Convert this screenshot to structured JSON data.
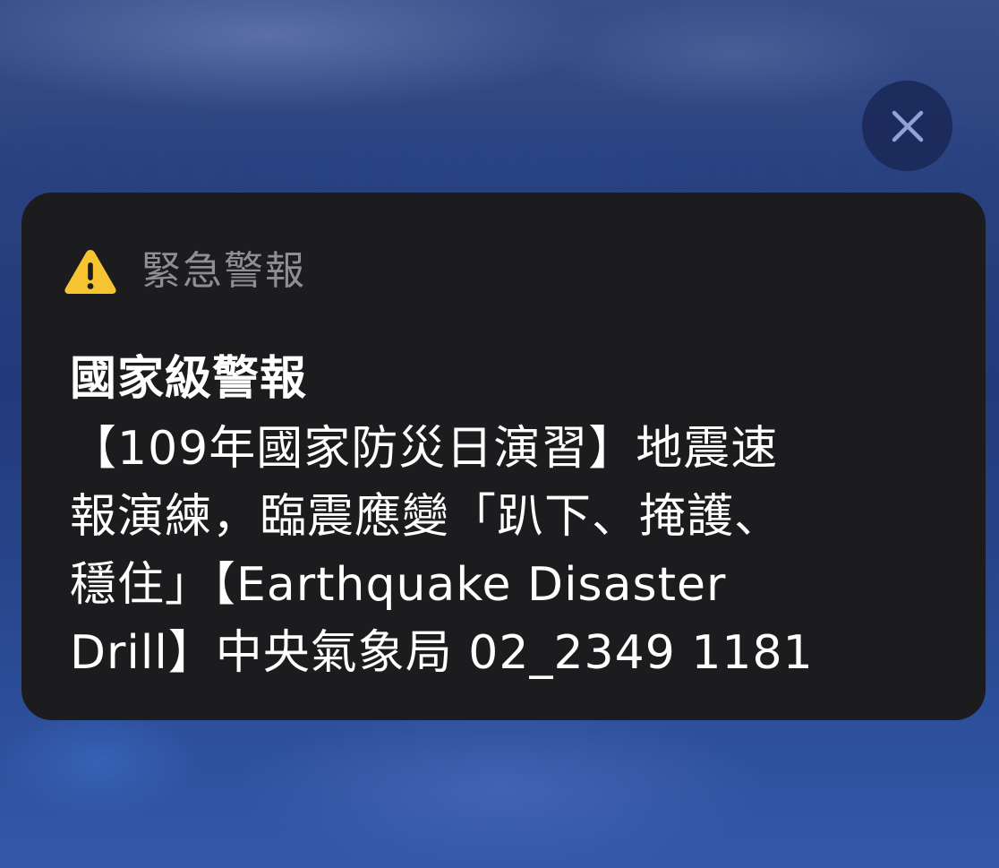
{
  "close_button": {
    "icon": "close-icon",
    "label": "×"
  },
  "alert": {
    "icon": "warning-icon",
    "icon_color": "#f6c431",
    "category": "緊急警報",
    "title": "國家級警報",
    "body_lines": [
      "【109年國家防災日演習】地震速",
      "報演練，臨震應變「趴下、掩護、",
      "穩住」【Earthquake Disaster",
      "Drill】中央氣象局 02_2349 1181"
    ]
  },
  "colors": {
    "card_background": "#1c1c1e",
    "category_text": "#8e8e93",
    "body_text": "#ffffff",
    "close_button_background": "#18264f",
    "close_icon": "#8fa3d8"
  }
}
